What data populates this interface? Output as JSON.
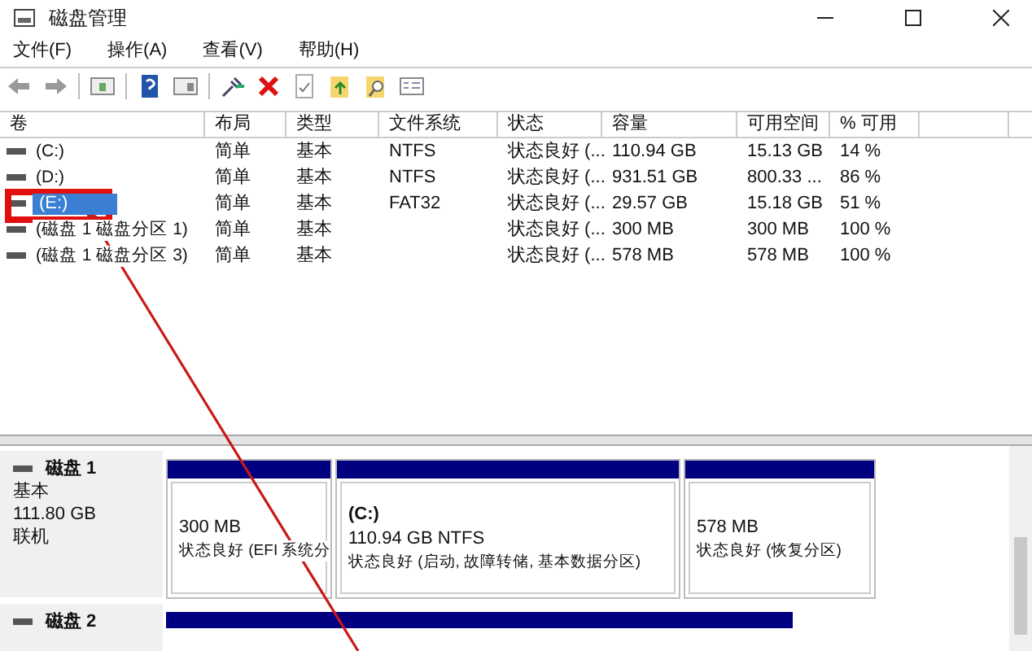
{
  "window": {
    "title": "磁盘管理"
  },
  "menu": [
    "文件(F)",
    "操作(A)",
    "查看(V)",
    "帮助(H)"
  ],
  "table": {
    "columns": [
      "卷",
      "布局",
      "类型",
      "文件系统",
      "状态",
      "容量",
      "可用空间",
      "% 可用"
    ],
    "rows": [
      {
        "cells": [
          "(C:)",
          "简单",
          "基本",
          "NTFS",
          "状态良好 (...",
          "110.94 GB",
          "15.13 GB",
          "14 %"
        ],
        "selected": false
      },
      {
        "cells": [
          "(D:)",
          "简单",
          "基本",
          "NTFS",
          "状态良好 (...",
          "931.51 GB",
          "800.33 ...",
          "86 %"
        ],
        "selected": false
      },
      {
        "cells": [
          "(E:)",
          "简单",
          "基本",
          "FAT32",
          "状态良好 (...",
          "29.57 GB",
          "15.18 GB",
          "51 %"
        ],
        "selected": true
      },
      {
        "cells": [
          "(磁盘 1 磁盘分区 1)",
          "简单",
          "基本",
          "",
          "状态良好 (...",
          "300 MB",
          "300 MB",
          "100 %"
        ],
        "selected": false
      },
      {
        "cells": [
          "(磁盘 1 磁盘分区 3)",
          "简单",
          "基本",
          "",
          "状态良好 (...",
          "578 MB",
          "578 MB",
          "100 %"
        ],
        "selected": false
      }
    ]
  },
  "disks": [
    {
      "name": "磁盘 1",
      "type": "基本",
      "size": "111.80 GB",
      "status": "联机",
      "partitions": [
        {
          "size": "300 MB",
          "status": "状态良好 (EFI 系统分"
        },
        {
          "label": "(C:)",
          "size": "110.94 GB NTFS",
          "status": "状态良好 (启动, 故障转储, 基本数据分区)"
        },
        {
          "size": "578 MB",
          "status": "状态良好 (恢复分区)"
        }
      ]
    },
    {
      "name": "磁盘 2"
    }
  ]
}
